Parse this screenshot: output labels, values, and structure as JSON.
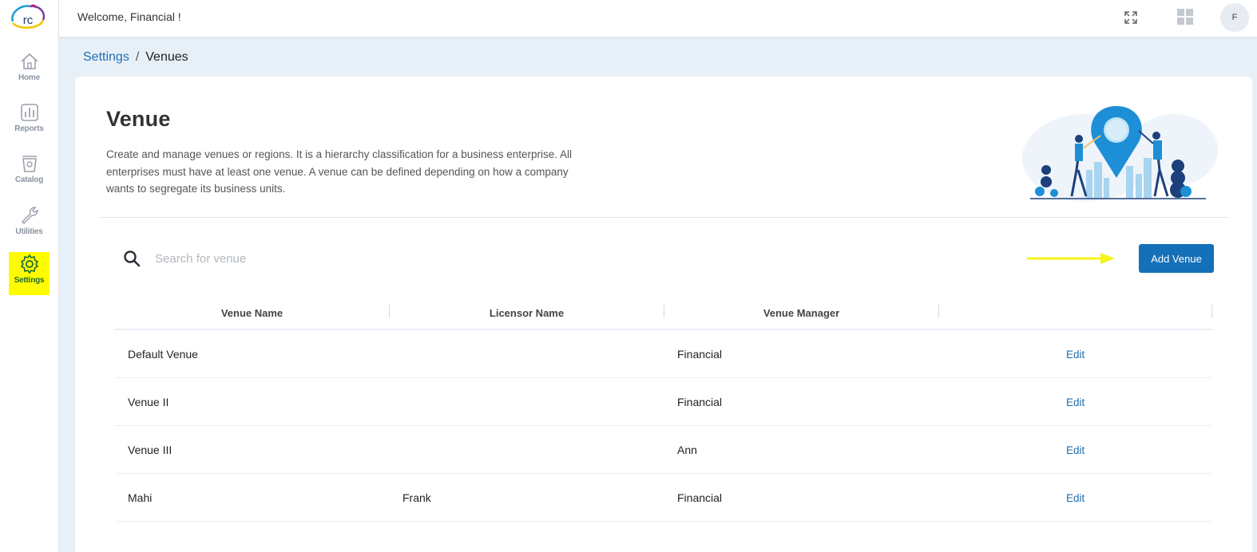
{
  "app": {
    "logo_text": "rc",
    "welcome": "Welcome, Financial !",
    "avatar_initial": "F"
  },
  "sidebar": {
    "items": [
      {
        "label": "Home",
        "icon": "home-icon"
      },
      {
        "label": "Reports",
        "icon": "bar-chart-icon"
      },
      {
        "label": "Catalog",
        "icon": "catalog-icon"
      },
      {
        "label": "Utilities",
        "icon": "wrench-icon"
      },
      {
        "label": "Settings",
        "icon": "gear-icon",
        "active": true
      }
    ]
  },
  "breadcrumb": {
    "parent": "Settings",
    "separator": "/",
    "current": "Venues"
  },
  "page": {
    "title": "Venue",
    "description": "Create and manage venues or regions. It is a hierarchy classification for a business enterprise. All enterprises must have at least one venue. A venue can be defined depending on how a company wants to segregate its business units."
  },
  "search": {
    "placeholder": "Search for venue",
    "value": ""
  },
  "toolbar": {
    "add_label": "Add Venue"
  },
  "table": {
    "columns": [
      "Venue Name",
      "Licensor Name",
      "Venue Manager",
      ""
    ],
    "rows": [
      {
        "venue": "Default Venue",
        "licensor": "",
        "manager": "Financial",
        "action": "Edit"
      },
      {
        "venue": "Venue II",
        "licensor": "",
        "manager": "Financial",
        "action": "Edit"
      },
      {
        "venue": "Venue III",
        "licensor": "",
        "manager": "Ann",
        "action": "Edit"
      },
      {
        "venue": "Mahi",
        "licensor": "Frank",
        "manager": "Financial",
        "action": "Edit"
      }
    ]
  },
  "colors": {
    "primary": "#1470b8",
    "link": "#1f6fb2",
    "highlight": "#fffc00",
    "annotation_arrow": "#f5f51a"
  }
}
